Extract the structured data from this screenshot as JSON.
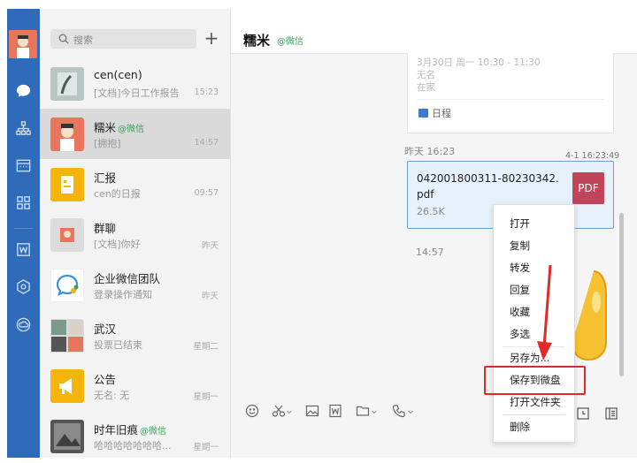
{
  "search": {
    "placeholder": "搜索",
    "add": "+"
  },
  "conversations": [
    {
      "name": "cen(cen)",
      "tag": "",
      "preview": "[文档]今日工作报告",
      "time": "15:23"
    },
    {
      "name": "糯米",
      "tag": "@微信",
      "preview": "[拥抱]",
      "time": "14:57"
    },
    {
      "name": "汇报",
      "tag": "",
      "preview": "cen的日报",
      "time": "09:57"
    },
    {
      "name": "群聊",
      "tag": "",
      "preview": "[文档]你好",
      "time": "昨天"
    },
    {
      "name": "企业微信团队",
      "tag": "",
      "preview": "登录操作通知",
      "time": "昨天"
    },
    {
      "name": "武汉",
      "tag": "",
      "preview": "投票已结束",
      "time": "星期二"
    },
    {
      "name": "公告",
      "tag": "",
      "preview": "无名: 无",
      "time": "星期一"
    },
    {
      "name": "时年旧痕",
      "tag": "@微信",
      "preview": "哈哈哈哈哈哈哈...",
      "time": "星期一"
    }
  ],
  "chat": {
    "title": "糯米",
    "subtitle": "@微信",
    "card": {
      "line1": "3月30日 周一 10:30 - 11:30",
      "line2": "无名",
      "line3": "在家",
      "footer": "日程"
    },
    "ts_yesterday": "昨天 16:23",
    "ts_file": "4-1 16:23:49",
    "file": {
      "name1": "042001800311-80230342.",
      "name2": "pdf",
      "size": "26.5K",
      "badge": "PDF"
    },
    "ts_sticker": "14:57"
  },
  "menu": {
    "items": [
      "打开",
      "复制",
      "转发",
      "回复",
      "收藏",
      "多选",
      "另存为...",
      "保存到微盘",
      "打开文件夹",
      "删除"
    ],
    "highlighted": "保存到微盘"
  },
  "colors": {
    "rail": "#2f6bb9",
    "accent_green": "#3ba35a",
    "pdf": "#c0455a",
    "highlight": "#e02a2a"
  },
  "icons": [
    "avatar",
    "chat-icon",
    "contacts-icon",
    "calendar-icon",
    "apps-icon",
    "doc-icon",
    "hexagon-icon",
    "cloud-icon",
    "search-icon",
    "plus-icon",
    "emoji-icon",
    "scissors-icon",
    "image-icon",
    "word-icon",
    "folder-icon",
    "phone-icon",
    "history-icon",
    "panel-icon"
  ]
}
